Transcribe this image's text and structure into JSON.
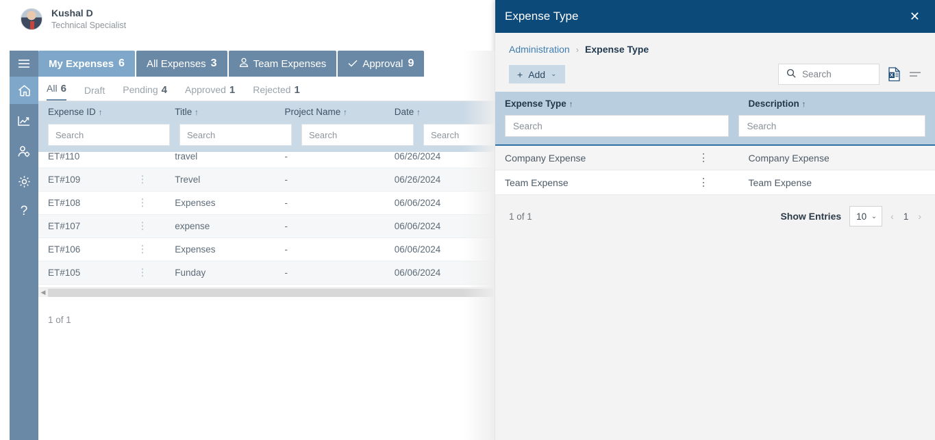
{
  "user": {
    "name": "Kushal D",
    "role": "Technical Specialist",
    "avatar_icon": "user-avatar-photo"
  },
  "sidebar": {
    "items": [
      {
        "name": "menu-toggle",
        "icon": "hamburger-icon",
        "active": false
      },
      {
        "name": "home",
        "icon": "home-icon",
        "active": true
      },
      {
        "name": "reports",
        "icon": "chart-line-icon",
        "active": false
      },
      {
        "name": "user-admin",
        "icon": "user-settings-icon",
        "active": false
      },
      {
        "name": "settings",
        "icon": "gear-icon",
        "active": false
      },
      {
        "name": "help",
        "icon": "question-mark-icon",
        "active": false
      }
    ]
  },
  "main": {
    "tabs": [
      {
        "label": "My Expenses",
        "count": "6",
        "icon": "",
        "active": true
      },
      {
        "label": "All Expenses",
        "count": "3",
        "icon": "",
        "active": false
      },
      {
        "label": "Team Expenses",
        "count": "",
        "icon": "person-icon",
        "active": false
      },
      {
        "label": "Approval",
        "count": "9",
        "icon": "check-icon",
        "active": false
      }
    ],
    "subtabs": [
      {
        "label": "All",
        "count": "6",
        "active": true
      },
      {
        "label": "Draft",
        "count": "",
        "active": false
      },
      {
        "label": "Pending",
        "count": "4",
        "active": false
      },
      {
        "label": "Approved",
        "count": "1",
        "active": false
      },
      {
        "label": "Rejected",
        "count": "1",
        "active": false
      }
    ],
    "table": {
      "columns": [
        {
          "label": "Expense ID",
          "sort": "↑",
          "search_placeholder": "Search"
        },
        {
          "label": "Title",
          "sort": "↑",
          "search_placeholder": "Search"
        },
        {
          "label": "Project Name",
          "sort": "↑",
          "search_placeholder": "Search"
        },
        {
          "label": "Date",
          "sort": "↑",
          "search_placeholder": "Search"
        }
      ],
      "rows": [
        {
          "id": "ET#110",
          "title": "travel",
          "project": "-",
          "date": "06/26/2024"
        },
        {
          "id": "ET#109",
          "title": "Trevel",
          "project": "-",
          "date": "06/26/2024"
        },
        {
          "id": "ET#108",
          "title": "Expenses",
          "project": "-",
          "date": "06/06/2024"
        },
        {
          "id": "ET#107",
          "title": "expense",
          "project": "-",
          "date": "06/06/2024"
        },
        {
          "id": "ET#106",
          "title": "Expenses",
          "project": "-",
          "date": "06/06/2024"
        },
        {
          "id": "ET#105",
          "title": "Funday",
          "project": "-",
          "date": "06/06/2024"
        }
      ]
    },
    "footer_count": "1 of 1"
  },
  "panel": {
    "title": "Expense Type",
    "close_icon": "close-icon",
    "breadcrumb": {
      "parent": "Administration",
      "separator": "›",
      "current": "Expense Type"
    },
    "toolbar": {
      "add_label": "Add",
      "add_plus": "+",
      "add_chevron": "⌄",
      "search_placeholder": "Search",
      "search_icon": "search-icon",
      "excel_icon": "excel-export-icon",
      "menu_icon": "list-menu-icon"
    },
    "table": {
      "columns": [
        {
          "label": "Expense Type",
          "sort": "↑",
          "search_placeholder": "Search"
        },
        {
          "label": "Description",
          "sort": "↑",
          "search_placeholder": "Search"
        }
      ],
      "rows": [
        {
          "type": "Company Expense",
          "description": "Company Expense"
        },
        {
          "type": "Team Expense",
          "description": "Team Expense"
        }
      ]
    },
    "footer": {
      "count": "1 of 1",
      "show_entries_label": "Show Entries",
      "entries_value": "10",
      "entries_chevron": "⌄",
      "prev_icon": "‹",
      "page": "1",
      "next_icon": "›"
    }
  },
  "colors": {
    "panel_header": "#0c4a7a",
    "rail": "#6a89a6",
    "tab_active": "#7ea7c9",
    "table_header": "#c9d9e6",
    "panel_table_header": "#b9cfdf",
    "accent_link": "#3e7cb1"
  }
}
